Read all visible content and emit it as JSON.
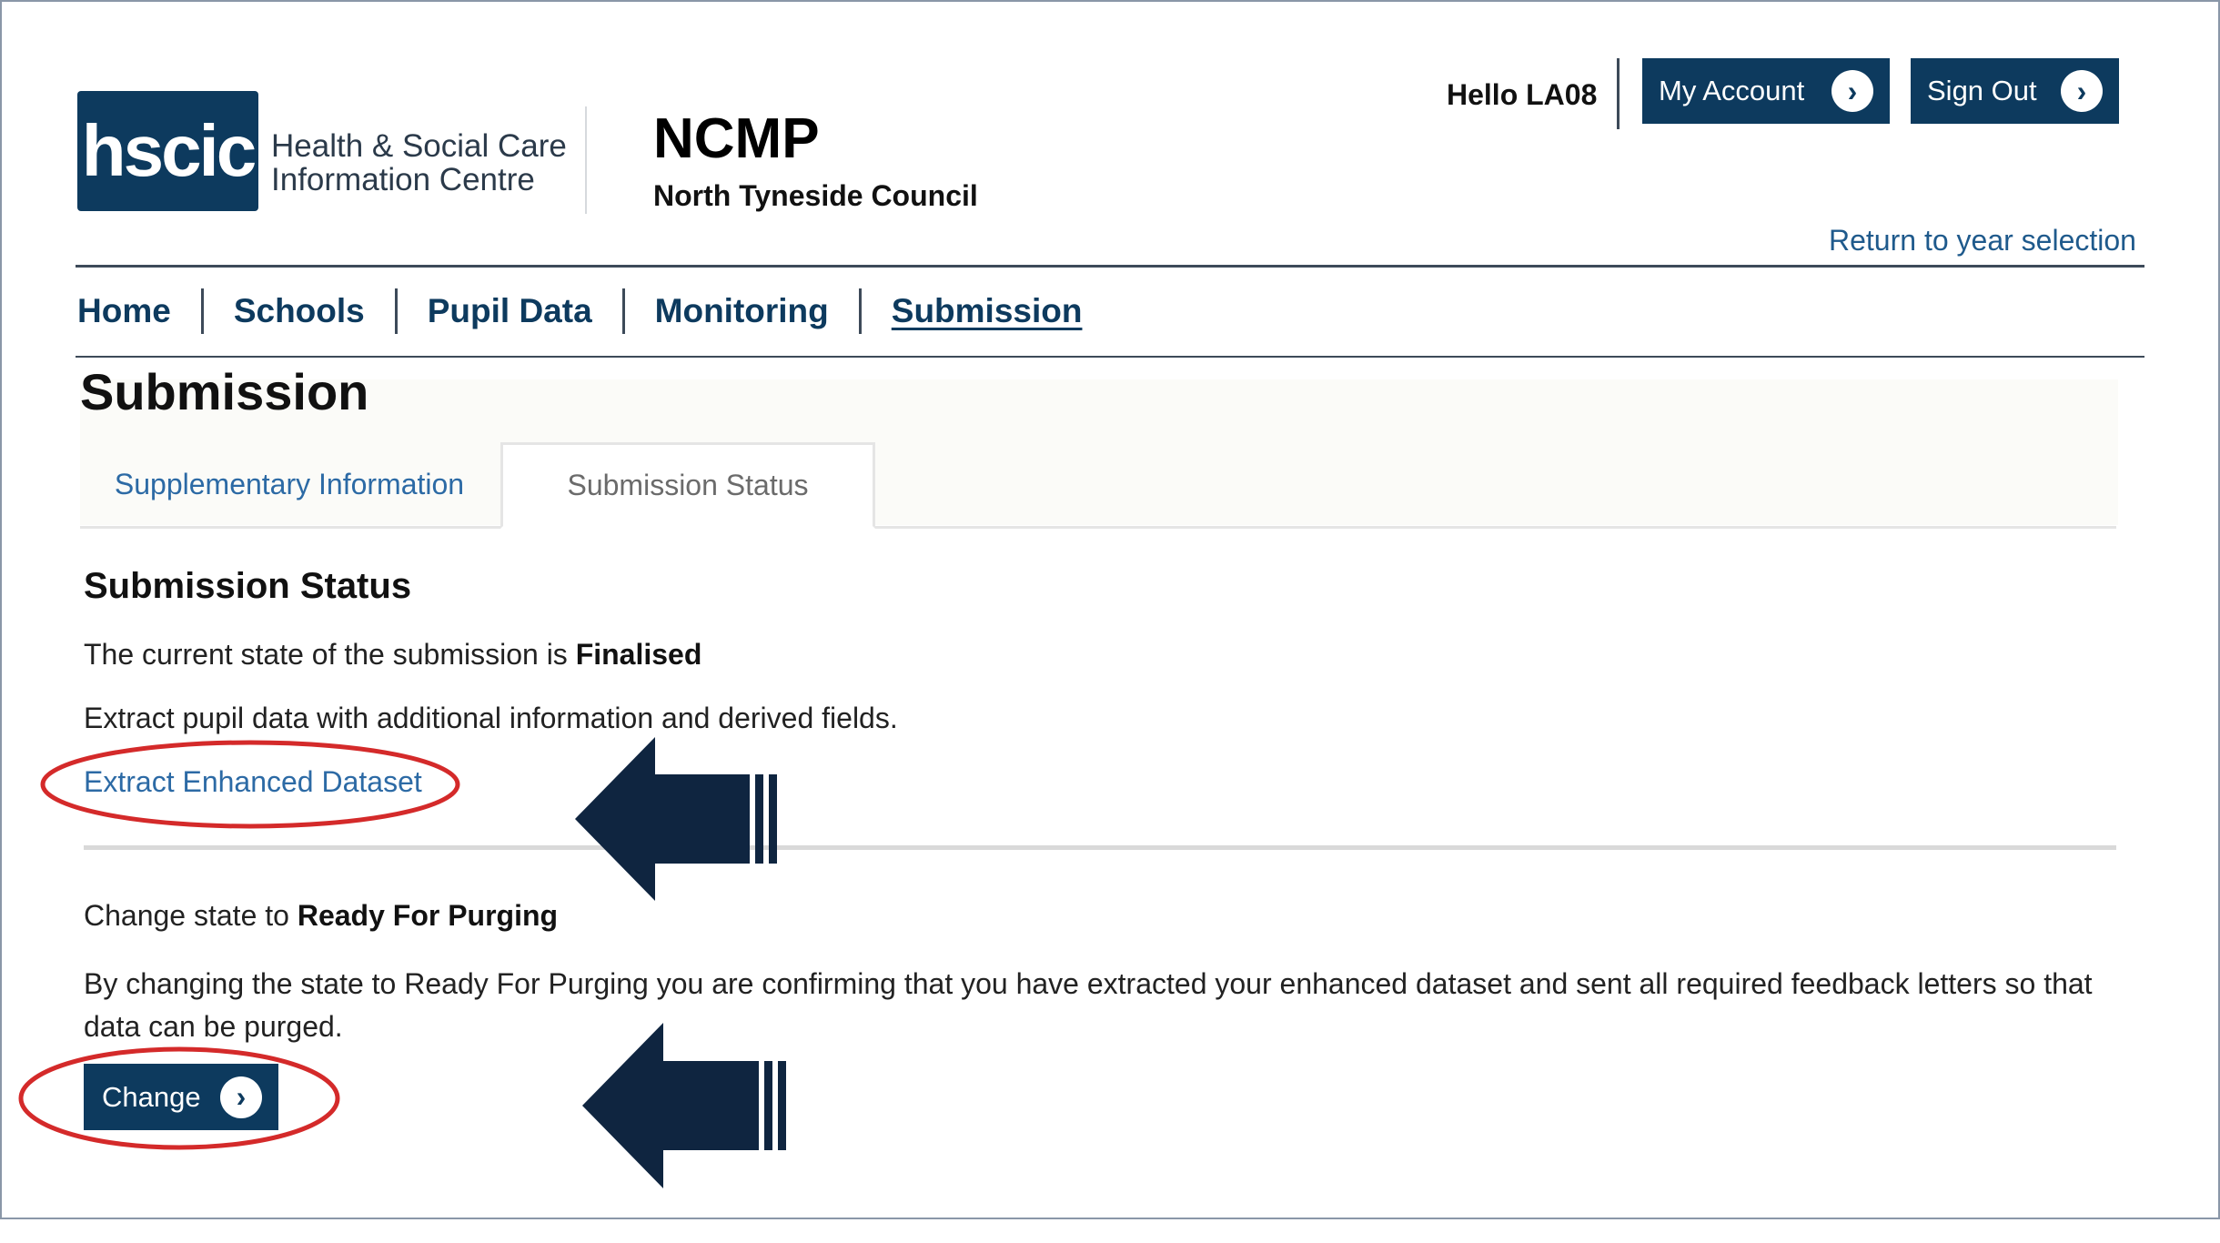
{
  "brand": {
    "logo_text": "hscic",
    "org_line1": "Health & Social Care",
    "org_line2": "Information Centre"
  },
  "app": {
    "title": "NCMP",
    "council": "North Tyneside Council"
  },
  "user": {
    "greeting": "Hello LA08",
    "my_account_label": "My Account",
    "sign_out_label": "Sign Out",
    "return_link": "Return to year selection"
  },
  "nav": {
    "items": [
      {
        "label": "Home"
      },
      {
        "label": "Schools"
      },
      {
        "label": "Pupil Data"
      },
      {
        "label": "Monitoring"
      },
      {
        "label": "Submission"
      }
    ],
    "active": "Submission"
  },
  "page": {
    "heading": "Submission",
    "tabs": [
      {
        "label": "Supplementary Information"
      },
      {
        "label": "Submission Status"
      }
    ],
    "section_title": "Submission Status",
    "state_prefix": "The current state of the submission is ",
    "state_value": "Finalised",
    "extract_description": "Extract pupil data with additional information and derived fields.",
    "extract_link": "Extract Enhanced Dataset",
    "change_prefix": "Change state to ",
    "change_target": "Ready For Purging",
    "purge_description": "By changing the state to Ready For Purging you are confirming that you have extracted your enhanced dataset and sent all required feedback letters so that data can be purged.",
    "change_button": "Change"
  },
  "icons": {
    "button_arrow": "chevron-right-circle-icon",
    "annotation_arrow": "left-arrow-icon"
  },
  "colors": {
    "brand_navy": "#0d3a5e",
    "link_blue": "#2c6aa5",
    "annotation_red": "#d42a2a",
    "arrow_navy": "#0f2540"
  }
}
